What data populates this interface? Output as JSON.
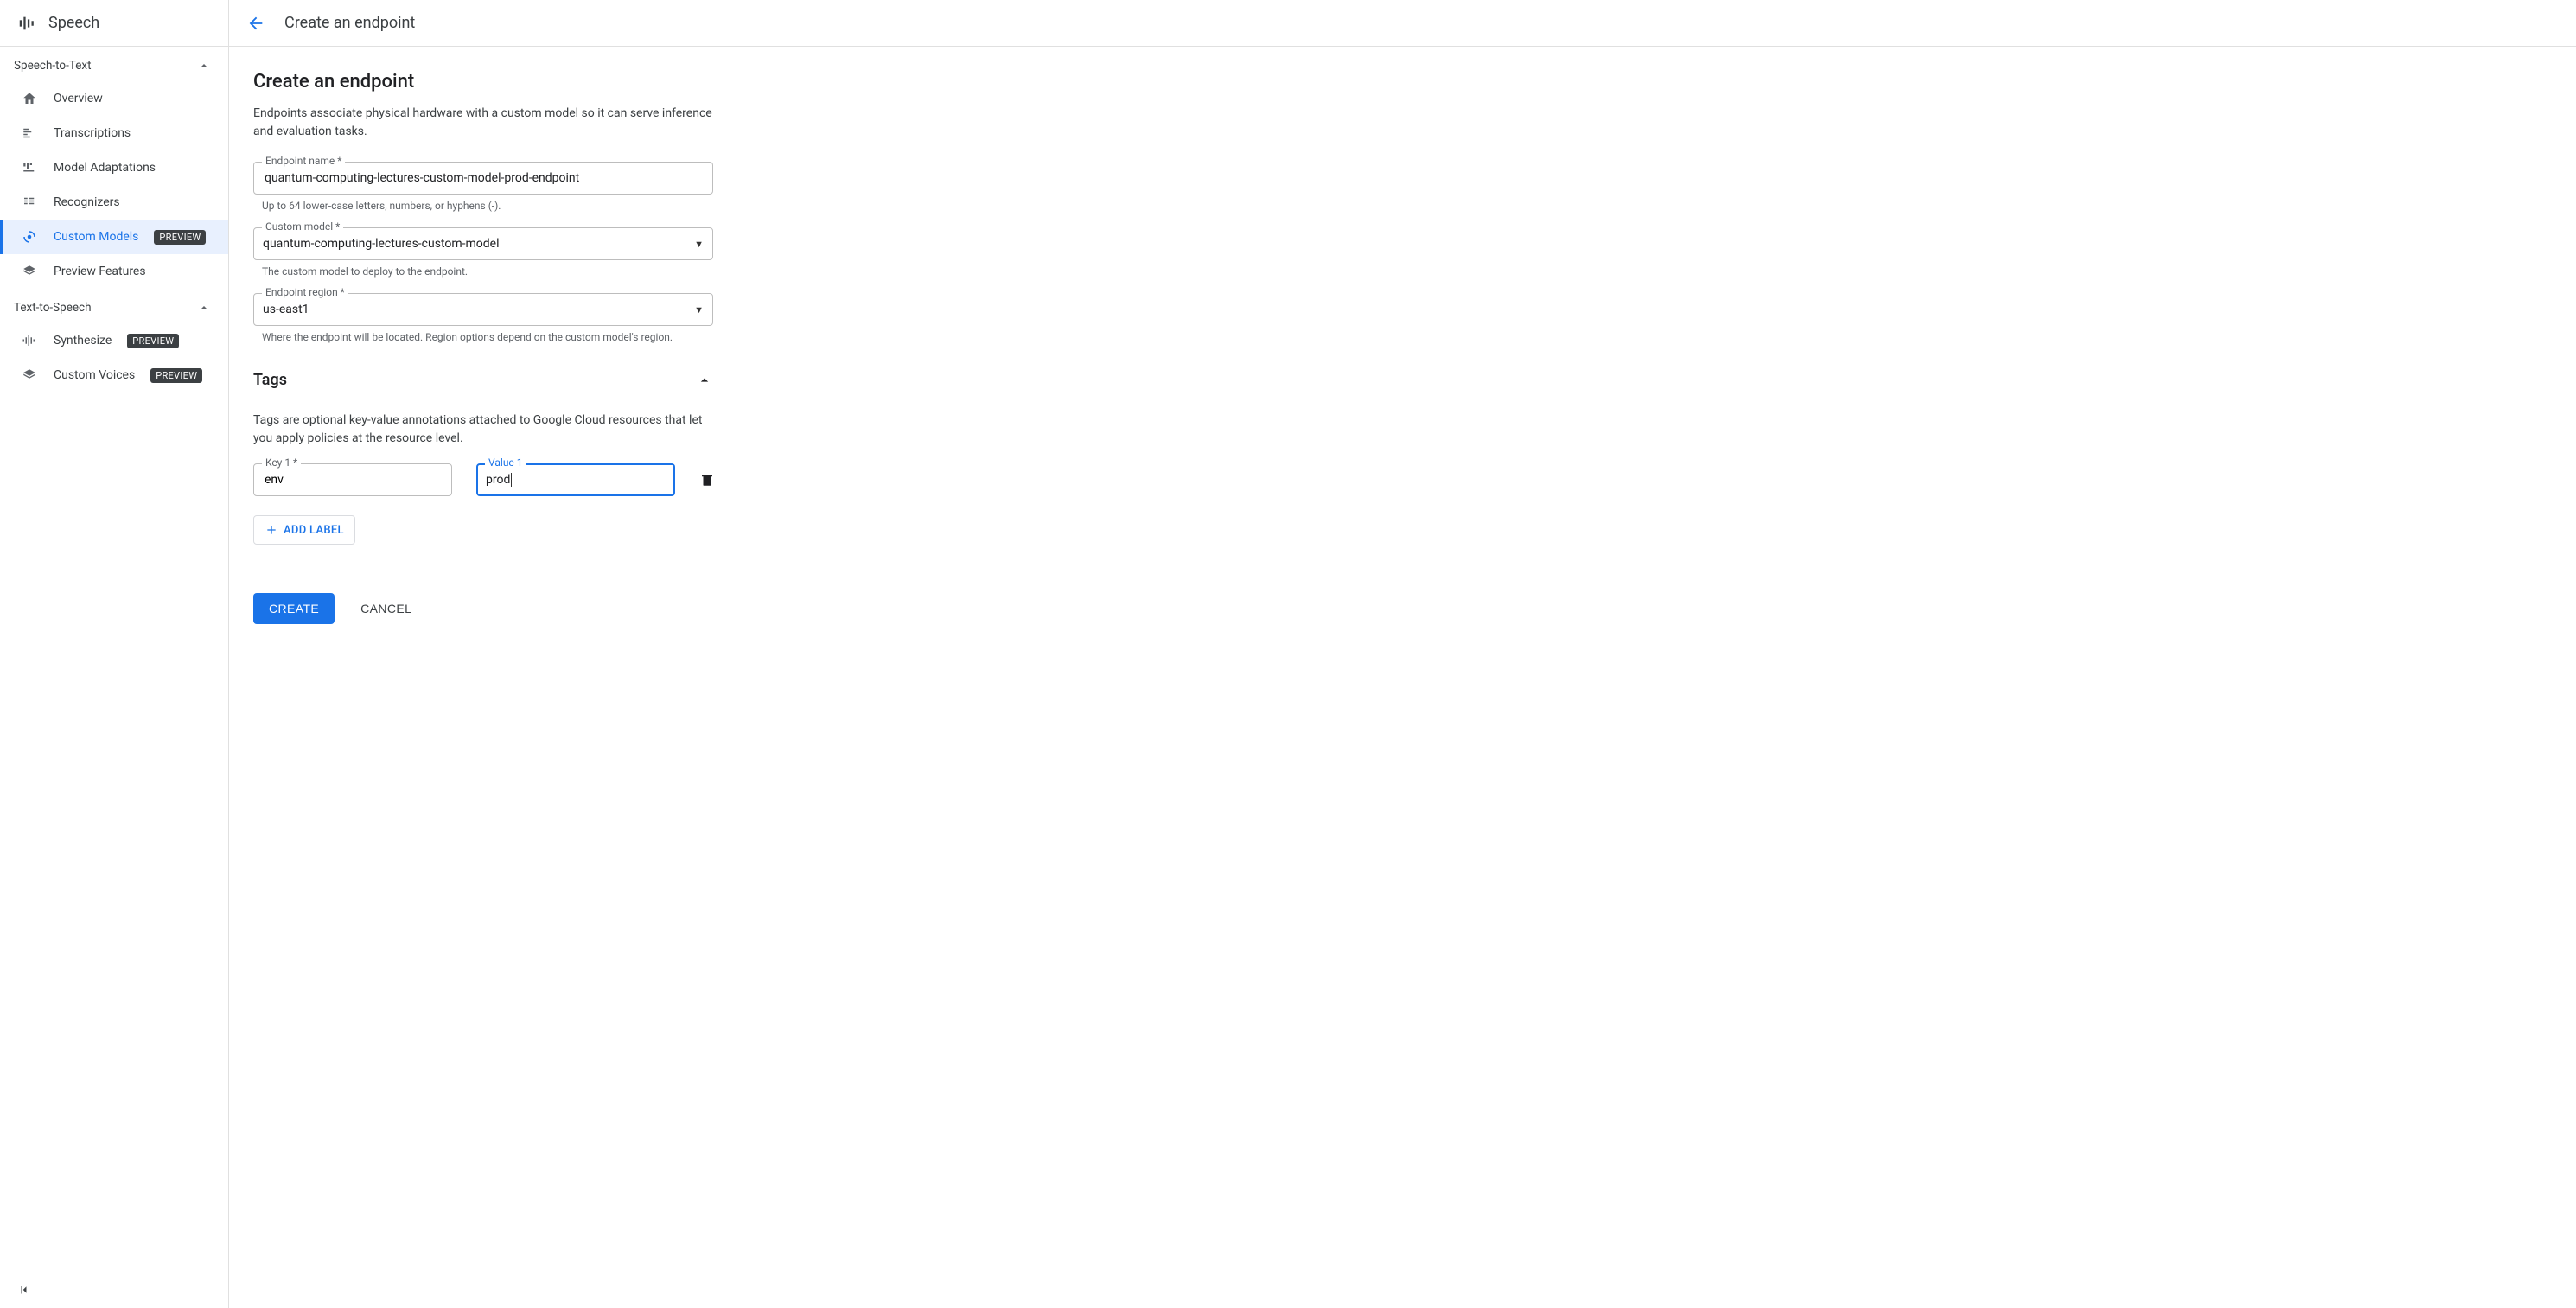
{
  "product_title": "Speech",
  "sidebar": {
    "sections": [
      {
        "title": "Speech-to-Text",
        "items": [
          {
            "label": "Overview",
            "badge": null
          },
          {
            "label": "Transcriptions",
            "badge": null
          },
          {
            "label": "Model Adaptations",
            "badge": null
          },
          {
            "label": "Recognizers",
            "badge": null
          },
          {
            "label": "Custom Models",
            "badge": "PREVIEW"
          },
          {
            "label": "Preview Features",
            "badge": null
          }
        ]
      },
      {
        "title": "Text-to-Speech",
        "items": [
          {
            "label": "Synthesize",
            "badge": "PREVIEW"
          },
          {
            "label": "Custom Voices",
            "badge": "PREVIEW"
          }
        ]
      }
    ]
  },
  "topbar": {
    "title": "Create an endpoint"
  },
  "page": {
    "title": "Create an endpoint",
    "description": "Endpoints associate physical hardware with a custom model so it can serve inference and evaluation tasks.",
    "fields": {
      "endpoint_name": {
        "label": "Endpoint name *",
        "value": "quantum-computing-lectures-custom-model-prod-endpoint",
        "helper": "Up to 64 lower-case letters, numbers, or hyphens (-)."
      },
      "custom_model": {
        "label": "Custom model *",
        "value": "quantum-computing-lectures-custom-model",
        "helper": "The custom model to deploy to the endpoint."
      },
      "endpoint_region": {
        "label": "Endpoint region *",
        "value": "us-east1",
        "helper": "Where the endpoint will be located. Region options depend on the custom model's region."
      }
    },
    "tags": {
      "title": "Tags",
      "description": "Tags are optional key-value annotations attached to Google Cloud resources that let you apply policies at the resource level.",
      "rows": [
        {
          "key_label": "Key 1 *",
          "key_value": "env",
          "value_label": "Value 1",
          "value_value": "prod"
        }
      ],
      "add_label": "ADD LABEL"
    },
    "actions": {
      "create": "CREATE",
      "cancel": "CANCEL"
    }
  }
}
